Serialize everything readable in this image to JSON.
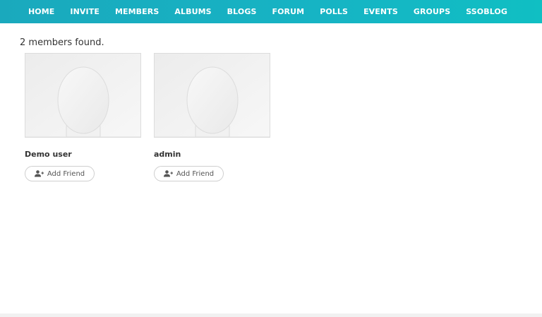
{
  "nav": {
    "items": [
      {
        "label": "HOME"
      },
      {
        "label": "INVITE"
      },
      {
        "label": "MEMBERS"
      },
      {
        "label": "ALBUMS"
      },
      {
        "label": "BLOGS"
      },
      {
        "label": "FORUM"
      },
      {
        "label": "POLLS"
      },
      {
        "label": "EVENTS"
      },
      {
        "label": "GROUPS"
      },
      {
        "label": "SSOBLOG"
      }
    ]
  },
  "main": {
    "result_count": "2 members found.",
    "members": [
      {
        "name": "Demo user",
        "button_label": "Add Friend",
        "avatar_icon": "default-avatar-icon",
        "button_icon": "user-plus-icon"
      },
      {
        "name": "admin",
        "button_label": "Add Friend",
        "avatar_icon": "default-avatar-icon",
        "button_icon": "user-plus-icon"
      }
    ]
  },
  "colors": {
    "nav_bg": "#16b4c4",
    "nav_text": "#ffffff"
  }
}
